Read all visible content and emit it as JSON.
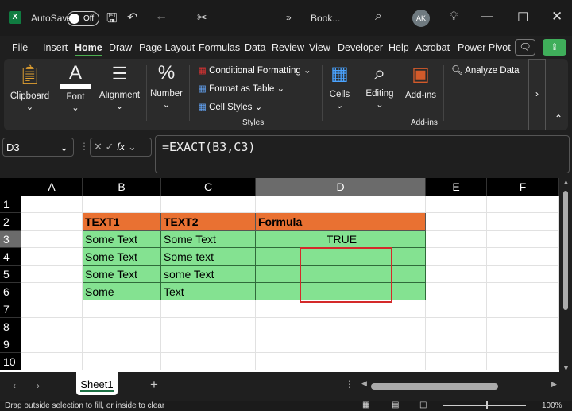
{
  "title_bar": {
    "autosave_label": "AutoSave",
    "autosave_state": "Off",
    "filename": "Book...",
    "avatar": "AK"
  },
  "menu": [
    "File",
    "Insert",
    "Home",
    "Draw",
    "Page Layout",
    "Formulas",
    "Data",
    "Review",
    "View",
    "Developer",
    "Help",
    "Acrobat",
    "Power Pivot"
  ],
  "active_menu": "Home",
  "ribbon": {
    "clipboard": "Clipboard",
    "font": "Font",
    "alignment": "Alignment",
    "number": "Number",
    "conditional_formatting": "Conditional Formatting",
    "format_as_table": "Format as Table",
    "cell_styles": "Cell Styles",
    "styles": "Styles",
    "cells": "Cells",
    "editing": "Editing",
    "addins": "Add-ins",
    "addins_group": "Add-ins",
    "analyze_data": "Analyze Data"
  },
  "formula_bar": {
    "name_box": "D3",
    "fx": "fx",
    "formula": "=EXACT(B3,C3)"
  },
  "columns": [
    "A",
    "B",
    "C",
    "D",
    "E",
    "F"
  ],
  "rows": [
    "1",
    "2",
    "3",
    "4",
    "5",
    "6",
    "7",
    "8",
    "9",
    "10"
  ],
  "table": {
    "headers": [
      "TEXT1",
      "TEXT2",
      "Formula"
    ],
    "rows": [
      [
        "Some Text",
        "Some Text",
        "TRUE"
      ],
      [
        "Some Text",
        "Some text",
        ""
      ],
      [
        "Some Text",
        "some Text",
        ""
      ],
      [
        "Some",
        "Text",
        ""
      ]
    ]
  },
  "sheet_tab": "Sheet1",
  "status": {
    "message": "Drag outside selection to fill, or inside to clear",
    "zoom": "100%"
  },
  "colors": {
    "header_fill": "#e97132",
    "data_fill": "#84e291",
    "highlight_box": "#d42a2a",
    "accent": "#4caf50"
  }
}
